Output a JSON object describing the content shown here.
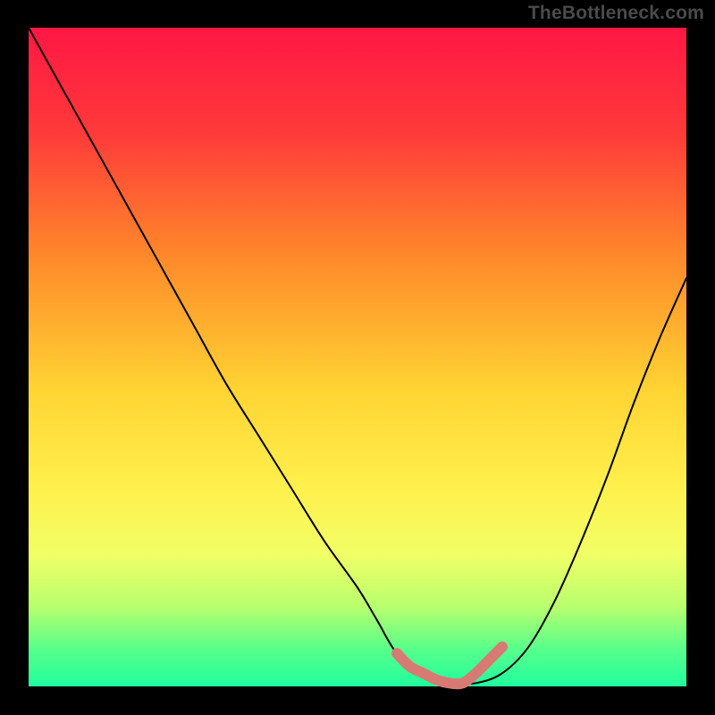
{
  "watermark": "TheBottleneck.com",
  "chart_data": {
    "type": "line",
    "title": "",
    "xlabel": "",
    "ylabel": "",
    "xlim": [
      0,
      100
    ],
    "ylim": [
      0,
      100
    ],
    "background_gradient": {
      "stops": [
        {
          "offset": 0,
          "color": "#ff1744"
        },
        {
          "offset": 16,
          "color": "#ff3a3a"
        },
        {
          "offset": 35,
          "color": "#ff8a2a"
        },
        {
          "offset": 55,
          "color": "#ffd433"
        },
        {
          "offset": 70,
          "color": "#fff04d"
        },
        {
          "offset": 80,
          "color": "#f1ff66"
        },
        {
          "offset": 88,
          "color": "#b7ff6e"
        },
        {
          "offset": 94,
          "color": "#5dff8a"
        },
        {
          "offset": 100,
          "color": "#1fff9e"
        }
      ]
    },
    "curve": {
      "color": "#000000",
      "x": [
        0,
        5,
        10,
        15,
        20,
        25,
        30,
        35,
        40,
        45,
        50,
        53,
        56,
        60,
        64,
        68,
        72,
        76,
        80,
        84,
        88,
        92,
        96,
        100
      ],
      "y": [
        100,
        91,
        82,
        73,
        64,
        55,
        46,
        38,
        30,
        22,
        15,
        10,
        5,
        2,
        0.5,
        0.5,
        2,
        6,
        13,
        22,
        32,
        43,
        53,
        62
      ]
    },
    "trough_highlight": {
      "color": "#d87a74",
      "stroke_width": 12,
      "x": [
        56,
        58,
        60,
        62,
        64,
        66,
        68,
        70,
        72
      ],
      "y": [
        5.0,
        3.0,
        2.0,
        1.0,
        0.5,
        0.5,
        2.0,
        4.0,
        6.0
      ]
    },
    "trough_marker": {
      "color": "#d87a74",
      "x": 72,
      "y": 6,
      "r": 6
    }
  }
}
